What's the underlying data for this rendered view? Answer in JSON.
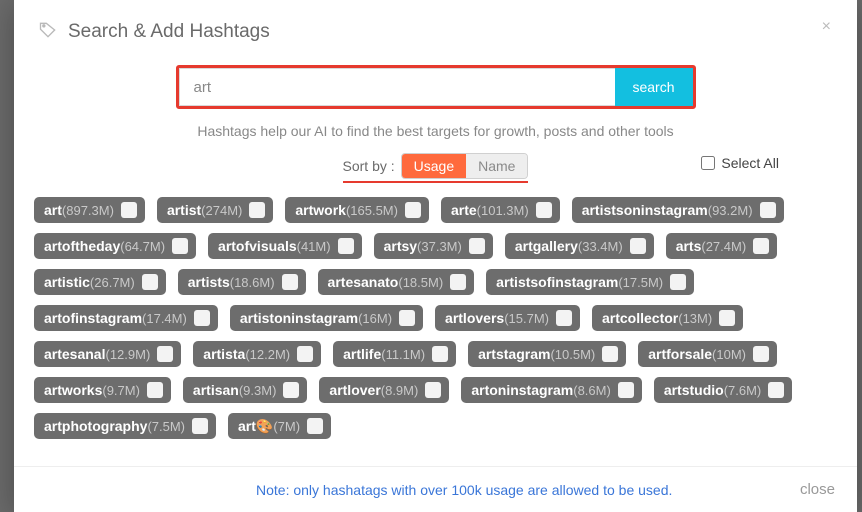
{
  "header": {
    "title": "Search & Add Hashtags"
  },
  "search": {
    "value": "art",
    "placeholder": "",
    "button": "search"
  },
  "helper_text": "Hashtags help our AI to find the best targets for growth, posts and other tools",
  "sort": {
    "label": "Sort by :",
    "options": [
      "Usage",
      "Name"
    ],
    "active": "Usage"
  },
  "select_all_label": "Select All",
  "hashtags": [
    {
      "name": "art",
      "count": "897.3M"
    },
    {
      "name": "artist",
      "count": "274M"
    },
    {
      "name": "artwork",
      "count": "165.5M"
    },
    {
      "name": "arte",
      "count": "101.3M"
    },
    {
      "name": "artistsoninstagram",
      "count": "93.2M"
    },
    {
      "name": "artoftheday",
      "count": "64.7M"
    },
    {
      "name": "artofvisuals",
      "count": "41M"
    },
    {
      "name": "artsy",
      "count": "37.3M"
    },
    {
      "name": "artgallery",
      "count": "33.4M"
    },
    {
      "name": "arts",
      "count": "27.4M"
    },
    {
      "name": "artistic",
      "count": "26.7M"
    },
    {
      "name": "artists",
      "count": "18.6M"
    },
    {
      "name": "artesanato",
      "count": "18.5M"
    },
    {
      "name": "artistsofinstagram",
      "count": "17.5M"
    },
    {
      "name": "artofinstagram",
      "count": "17.4M"
    },
    {
      "name": "artistoninstagram",
      "count": "16M"
    },
    {
      "name": "artlovers",
      "count": "15.7M"
    },
    {
      "name": "artcollector",
      "count": "13M"
    },
    {
      "name": "artesanal",
      "count": "12.9M"
    },
    {
      "name": "artista",
      "count": "12.2M"
    },
    {
      "name": "artlife",
      "count": "11.1M"
    },
    {
      "name": "artstagram",
      "count": "10.5M"
    },
    {
      "name": "artforsale",
      "count": "10M"
    },
    {
      "name": "artworks",
      "count": "9.7M"
    },
    {
      "name": "artisan",
      "count": "9.3M"
    },
    {
      "name": "artlover",
      "count": "8.9M"
    },
    {
      "name": "artoninstagram",
      "count": "8.6M"
    },
    {
      "name": "artstudio",
      "count": "7.6M"
    },
    {
      "name": "artphotography",
      "count": "7.5M"
    },
    {
      "name": "art🎨",
      "count": "7M"
    }
  ],
  "footer": {
    "note": "Note: only hashatags with over 100k usage are allowed to be used.",
    "close": "close"
  }
}
